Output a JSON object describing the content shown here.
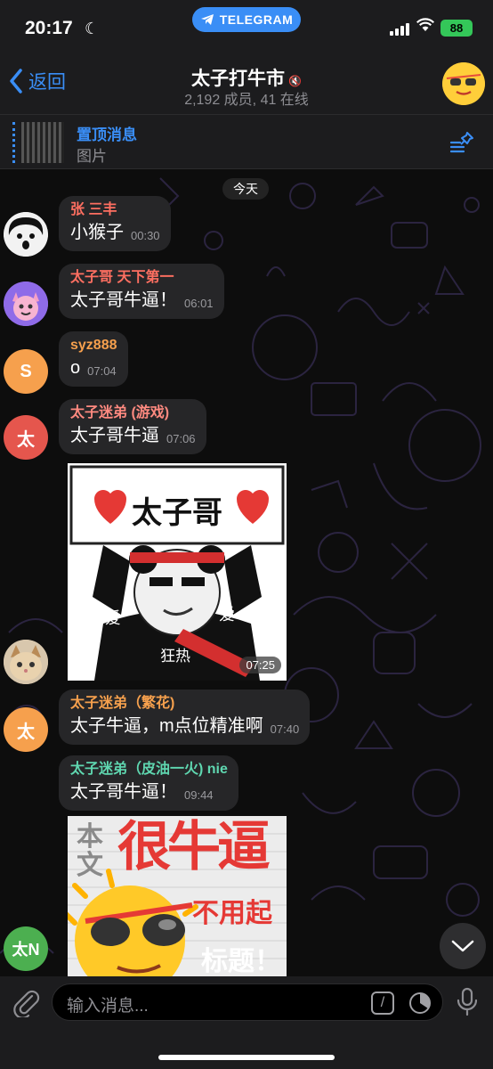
{
  "status_bar": {
    "time": "20:17",
    "pill_label": "TELEGRAM",
    "battery": "88"
  },
  "header": {
    "back_label": "返回",
    "title": "太子打牛市",
    "subtitle": "2,192 成员, 41 在线"
  },
  "pinned": {
    "title": "置顶消息",
    "text": "图片"
  },
  "date_separator": "今天",
  "messages": [
    {
      "sender": "张 三丰",
      "sender_color": "#ff6f61",
      "text": "小猴子",
      "time": "00:30"
    },
    {
      "sender": "太子哥 天下第一",
      "sender_color": "#ff6f61",
      "text": "太子哥牛逼！",
      "time": "06:01"
    },
    {
      "sender": "syz888",
      "sender_color": "#f6a04d",
      "avatar_letter": "S",
      "avatar_color": "#f6a04d",
      "text": "o",
      "time": "07:04"
    },
    {
      "sender": "太子迷弟 (游戏)",
      "sender_color": "#ff8a80",
      "avatar_letter": "太",
      "avatar_color": "#e5564d",
      "text": "太子哥牛逼",
      "time": "07:06"
    },
    {
      "sender": "太子迷弟（繁花)",
      "sender_color": "#f6a04d",
      "avatar_letter": "太",
      "avatar_color": "#f6a04d",
      "text": "太子牛逼，m点位精准啊",
      "time": "07:40"
    },
    {
      "sender": "太子迷弟（皮油一火) nie",
      "sender_color": "#5fd7b0",
      "text": "太子哥牛逼！",
      "time": "09:44"
    }
  ],
  "sticker1": {
    "banner": "太子哥",
    "left_word": "爱",
    "right_word": "爱",
    "sash_word": "狂热",
    "time": "07:25"
  },
  "sticker2": {
    "line1": "本",
    "line2": "文",
    "big_text": "很牛逼",
    "sub_text": "不用起",
    "bottom_text": "标题！"
  },
  "last_avatar": {
    "letters": "太N",
    "color": "#4caf50"
  },
  "input": {
    "placeholder": "输入消息..."
  },
  "colors": {
    "accent": "#3a8ef6",
    "bubble": "#262628",
    "bar": "#1c1c1e"
  }
}
